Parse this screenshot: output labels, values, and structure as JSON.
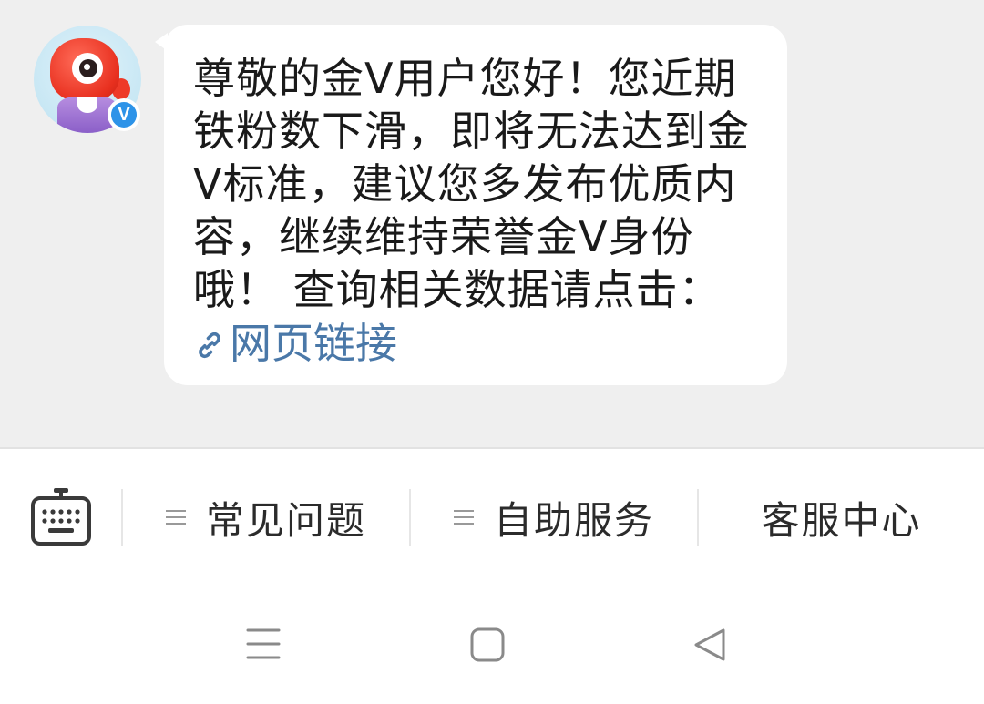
{
  "message": {
    "sender": "verified-official-account",
    "verified_badge": "V",
    "text": "尊敬的金V用户您好！您近期铁粉数下滑，即将无法达到金V标准，建议您多发布优质内容，继续维持荣誉金V身份哦！ 查询相关数据请点击：",
    "link_label": "网页链接",
    "link_color": "#4a78a8"
  },
  "toolbar": {
    "keyboard_icon": "keyboard-icon",
    "items": [
      {
        "label": "常见问题",
        "has_menu_icon": true
      },
      {
        "label": "自助服务",
        "has_menu_icon": true
      },
      {
        "label": "客服中心",
        "has_menu_icon": false
      }
    ]
  },
  "navbar": {
    "icons": [
      "menu-icon",
      "home-square-icon",
      "back-triangle-icon"
    ]
  },
  "colors": {
    "chat_background": "#efefef",
    "bubble": "#ffffff",
    "verified_blue": "#2d93e8",
    "avatar_red": "#e8301f"
  }
}
